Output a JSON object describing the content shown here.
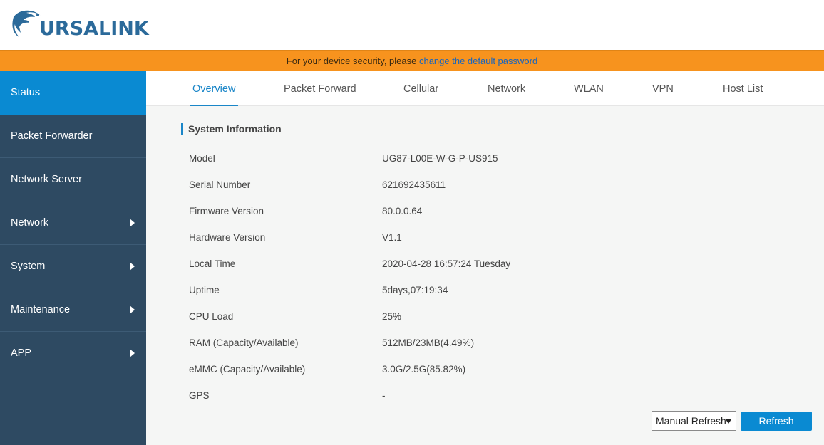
{
  "brand": {
    "logo_text": "URSALINK",
    "logo_icon": "bear-head-logo-icon",
    "logo_color": "#2b6a9a"
  },
  "notice": {
    "text": "For your device security, please ",
    "link_text": "change the default password",
    "background": "#f7931e"
  },
  "sidebar": {
    "items": [
      {
        "label": "Status",
        "active": true,
        "has_arrow": false
      },
      {
        "label": "Packet Forwarder",
        "active": false,
        "has_arrow": false
      },
      {
        "label": "Network Server",
        "active": false,
        "has_arrow": false
      },
      {
        "label": "Network",
        "active": false,
        "has_arrow": true
      },
      {
        "label": "System",
        "active": false,
        "has_arrow": true
      },
      {
        "label": "Maintenance",
        "active": false,
        "has_arrow": true
      },
      {
        "label": "APP",
        "active": false,
        "has_arrow": true
      }
    ],
    "background": "#2e4a62",
    "active_color": "#0a8ad2"
  },
  "tabs": [
    {
      "label": "Overview",
      "active": true
    },
    {
      "label": "Packet Forward",
      "active": false
    },
    {
      "label": "Cellular",
      "active": false
    },
    {
      "label": "Network",
      "active": false
    },
    {
      "label": "WLAN",
      "active": false
    },
    {
      "label": "VPN",
      "active": false
    },
    {
      "label": "Host List",
      "active": false
    }
  ],
  "system_info": {
    "title": "System Information",
    "rows": [
      {
        "label": "Model",
        "value": "UG87-L00E-W-G-P-US915"
      },
      {
        "label": "Serial Number",
        "value": "621692435611"
      },
      {
        "label": "Firmware Version",
        "value": "80.0.0.64"
      },
      {
        "label": "Hardware Version",
        "value": "V1.1"
      },
      {
        "label": "Local Time",
        "value": "2020-04-28 16:57:24 Tuesday"
      },
      {
        "label": "Uptime",
        "value": "5days,07:19:34"
      },
      {
        "label": "CPU Load",
        "value": "25%"
      },
      {
        "label": "RAM (Capacity/Available)",
        "value": "512MB/23MB(4.49%)"
      },
      {
        "label": "eMMC (Capacity/Available)",
        "value": "3.0G/2.5G(85.82%)"
      },
      {
        "label": "GPS",
        "value": "-"
      }
    ]
  },
  "controls": {
    "refresh_mode": "Manual Refresh",
    "refresh_button": "Refresh"
  }
}
